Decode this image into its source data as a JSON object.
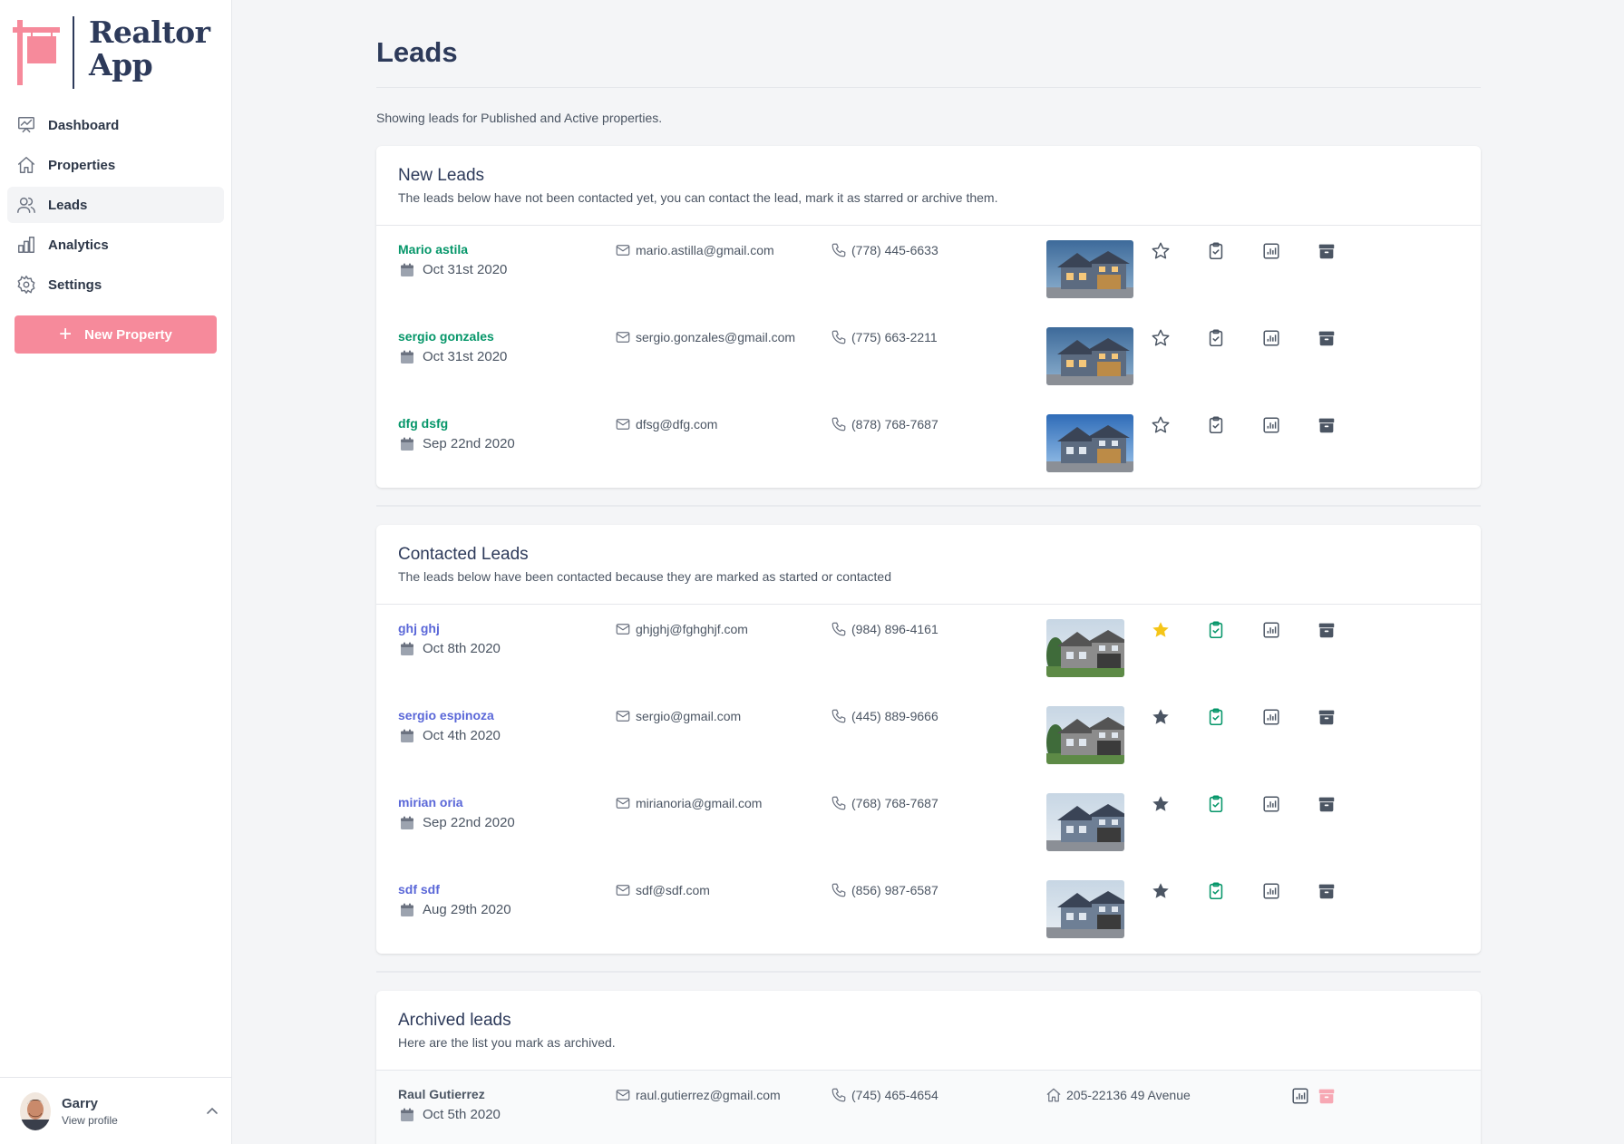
{
  "app": {
    "name_line1": "Realtor",
    "name_line2": "App"
  },
  "sidebar": {
    "items": [
      {
        "label": "Dashboard",
        "icon": "chart-presentation-icon"
      },
      {
        "label": "Properties",
        "icon": "home-icon"
      },
      {
        "label": "Leads",
        "icon": "users-icon",
        "active": true
      },
      {
        "label": "Analytics",
        "icon": "bar-chart-icon"
      },
      {
        "label": "Settings",
        "icon": "gear-icon"
      }
    ],
    "new_property_label": "New Property",
    "new_property_icon": "plus-icon"
  },
  "profile": {
    "name": "Garry",
    "sub": "View profile"
  },
  "page": {
    "title": "Leads",
    "subtitle": "Showing leads for Published and Active properties."
  },
  "new_leads": {
    "title": "New Leads",
    "description": "The leads below have not been contacted yet, you can contact the lead, mark it as starred or archive them.",
    "rows": [
      {
        "name": "Mario astila",
        "date": "Oct 31st 2020",
        "email": "mario.astilla@gmail.com",
        "phone": "(778) 445-6633"
      },
      {
        "name": "sergio gonzales",
        "date": "Oct 31st 2020",
        "email": "sergio.gonzales@gmail.com",
        "phone": "(775) 663-2211"
      },
      {
        "name": "dfg dsfg",
        "date": "Sep 22nd 2020",
        "email": "dfsg@dfg.com",
        "phone": "(878) 768-7687"
      }
    ]
  },
  "contacted_leads": {
    "title": "Contacted Leads",
    "description": "The leads below have been contacted because they are marked as started or contacted",
    "rows": [
      {
        "name": "ghj ghj",
        "date": "Oct 8th 2020",
        "email": "ghjghj@fghghjf.com",
        "phone": "(984) 896-4161",
        "starred": true
      },
      {
        "name": "sergio espinoza",
        "date": "Oct 4th 2020",
        "email": "sergio@gmail.com",
        "phone": "(445) 889-9666",
        "starred": false
      },
      {
        "name": "mirian oria",
        "date": "Sep 22nd 2020",
        "email": "mirianoria@gmail.com",
        "phone": "(768) 768-7687",
        "starred": false
      },
      {
        "name": "sdf sdf",
        "date": "Aug 29th 2020",
        "email": "sdf@sdf.com",
        "phone": "(856) 987-6587",
        "starred": false
      }
    ]
  },
  "archived_leads": {
    "title": "Archived leads",
    "description": "Here are the list you mark as archived.",
    "rows": [
      {
        "name": "Raul Gutierrez",
        "date": "Oct 5th 2020",
        "email": "raul.gutierrez@gmail.com",
        "phone": "(745) 465-4654",
        "address": "205-22136 49 Avenue"
      }
    ]
  },
  "colors": {
    "brand_pink": "#f68a9b",
    "new_lead_name": "#059669",
    "contacted_lead_name": "#5a67d8",
    "star_active": "#f5c518",
    "contacted_check": "#059669",
    "title_navy": "#2d3a5a"
  }
}
